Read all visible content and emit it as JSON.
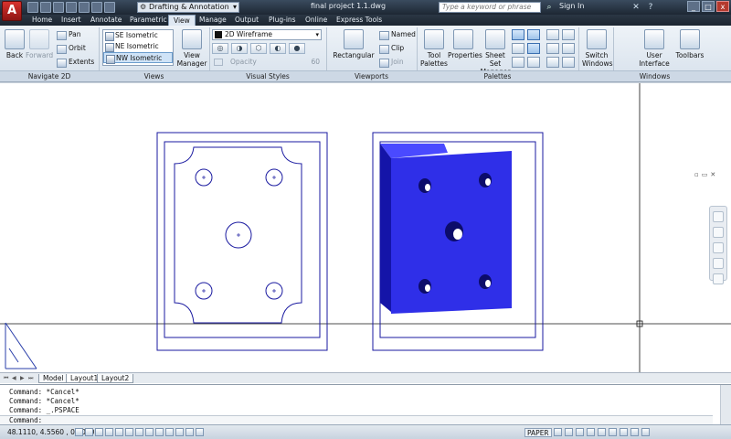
{
  "title_bar": {
    "workspace": "Drafting & Annotation",
    "document_title": "final project 1.1.dwg",
    "search_placeholder": "Type a keyword or phrase",
    "sign_in": "Sign In"
  },
  "tabs": [
    "Home",
    "Insert",
    "Annotate",
    "Parametric",
    "View",
    "Manage",
    "Output",
    "Plug-ins",
    "Online",
    "Express Tools"
  ],
  "active_tab": "View",
  "ribbon": {
    "navigate": {
      "back": "Back",
      "forward": "Forward",
      "pan": "Pan",
      "orbit": "Orbit",
      "extents": "Extents"
    },
    "views": {
      "items": [
        "SE Isometric",
        "NE Isometric",
        "NW Isometric"
      ],
      "selected": "NW Isometric",
      "view_manager": "View Manager"
    },
    "visual_styles": {
      "current": "2D Wireframe",
      "opacity_label": "Opacity",
      "opacity_value": "60"
    },
    "viewports": {
      "rectangular": "Rectangular",
      "named": "Named",
      "clip": "Clip",
      "join": "Join"
    },
    "palettes": {
      "tool_palettes": "Tool Palettes",
      "properties": "Properties",
      "sheet_set_manager": "Sheet Set Manager"
    },
    "windows": {
      "switch_windows": "Switch Windows",
      "user_interface": "User Interface",
      "toolbars": "Toolbars"
    },
    "panel_titles": {
      "navigate": "Navigate 2D",
      "views": "Views",
      "visual_styles": "Visual Styles",
      "viewports": "Viewports",
      "palettes": "Palettes",
      "windows": "Windows"
    }
  },
  "layout_tabs": [
    "Model",
    "Layout1",
    "Layout2"
  ],
  "active_layout": "Layout1",
  "command_history": [
    "Command: *Cancel*",
    "Command: *Cancel*",
    "Command: _.PSPACE"
  ],
  "command_prompt": "Command:",
  "status": {
    "coordinates": "48.1110, 4.5560 , 0.0000",
    "space": "PAPER"
  },
  "colors": {
    "title_bar": "#1d2733",
    "ribbon": "#d7e1ec",
    "drawing_lines": "#1a1aa0",
    "solid_front": "#2f2fe8",
    "solid_side": "#1414a8",
    "solid_top": "#4a4aff"
  }
}
